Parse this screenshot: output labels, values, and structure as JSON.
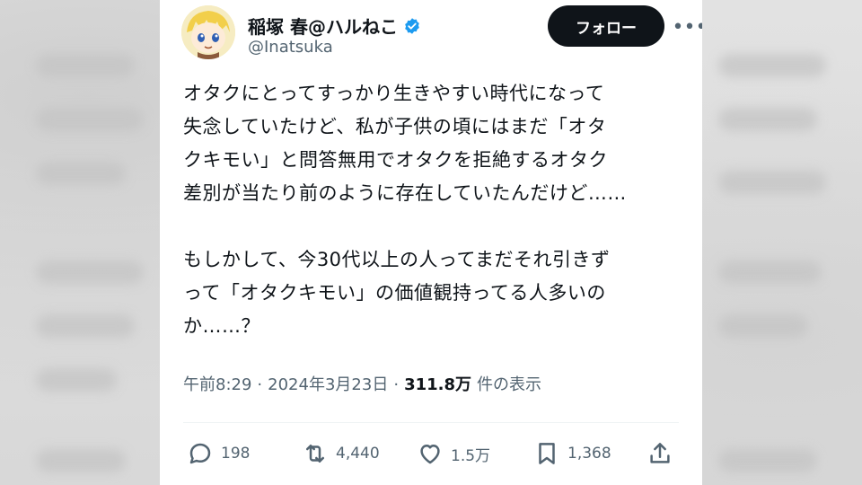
{
  "tweet": {
    "display_name": "稲塚 春@ハルねこ",
    "handle": "@Inatsuka",
    "follow_label": "フォロー",
    "more_label": "•••",
    "text": "オタクにとってすっかり生きやすい時代になって\n失念していたけど、私が子供の頃にはまだ「オタ\nクキモい」と問答無用でオタクを拒絶するオタク\n差別が当たり前のように存在していたんだけど……\n\nもしかして、今30代以上の人ってまだそれ引きず\nって「オタクキモい」の価値観持ってる人多いの\nか……？",
    "time": "午前8:29",
    "separator1": "·",
    "date": "2024年3月23日",
    "separator2": "·",
    "views_count": "311.8万",
    "views_label": "件の表示"
  },
  "actions": {
    "replies": "198",
    "reposts": "4,440",
    "likes": "1.5万",
    "bookmarks": "1,368"
  },
  "colors": {
    "accent_verified": "#1d9bf0",
    "text_primary": "#0f1419",
    "text_secondary": "#536471"
  },
  "icons": [
    "verified-badge-icon",
    "reply-icon",
    "repost-icon",
    "like-icon",
    "bookmark-icon",
    "share-icon"
  ]
}
